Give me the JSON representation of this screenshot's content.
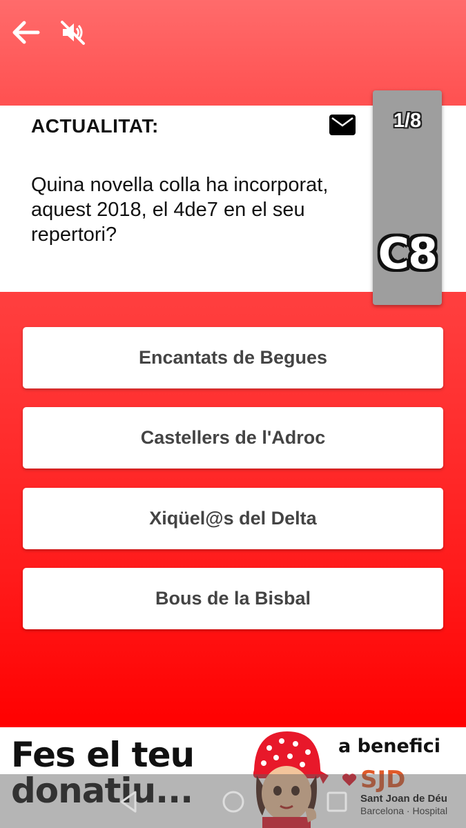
{
  "header": {
    "back_icon": "arrow-left-icon",
    "mute_icon": "volume-off-icon"
  },
  "question": {
    "category": "ACTUALITAT:",
    "mail_icon": "envelope-icon",
    "text": "Quina novella colla ha incorporat, aquest 2018, el 4de7 en el seu repertori?"
  },
  "side_panel": {
    "counter": "1/8",
    "badge": "C8"
  },
  "answers": [
    {
      "label": "Encantats de Begues"
    },
    {
      "label": "Castellers de l'Adroc"
    },
    {
      "label": "Xiqüel@s del Delta"
    },
    {
      "label": "Bous de la Bisbal"
    }
  ],
  "banner": {
    "headline": "Fes el teu donatiu...",
    "benefit": "a benefici",
    "logo_mark": "SJD",
    "hospital_name": "Sant Joan de Déu",
    "hospital_sub": "Barcelona · Hospital"
  },
  "colors": {
    "background_top": "#ff6b6b",
    "background_bottom": "#ff0000",
    "panel_gray": "#9e9e9e",
    "sjd_orange": "#e05a2a"
  }
}
